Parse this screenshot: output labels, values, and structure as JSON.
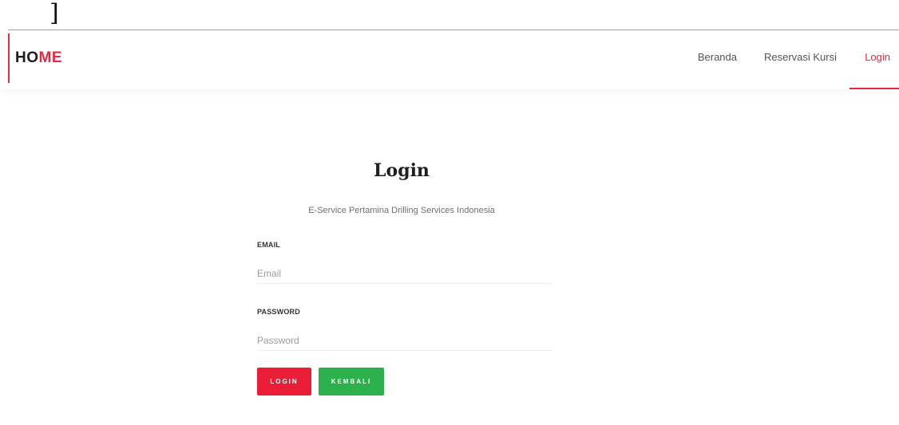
{
  "stray_text": "]",
  "navbar": {
    "brand_part1": "HO",
    "brand_part2": "ME",
    "links": [
      {
        "label": "Beranda",
        "active": false
      },
      {
        "label": "Reservasi Kursi",
        "active": false
      },
      {
        "label": "Login",
        "active": true
      }
    ]
  },
  "form": {
    "title": "Login",
    "subtitle": "E-Service Pertamina Drilling Services Indonesia",
    "email_label": "EMAIL",
    "email_placeholder": "Email",
    "email_value": "",
    "password_label": "PASSWORD",
    "password_placeholder": "Password",
    "password_value": "",
    "login_button": "LOGIN",
    "back_button": "KEMBALI"
  },
  "colors": {
    "accent_red": "#e8283f",
    "button_green": "#2bb04b"
  }
}
